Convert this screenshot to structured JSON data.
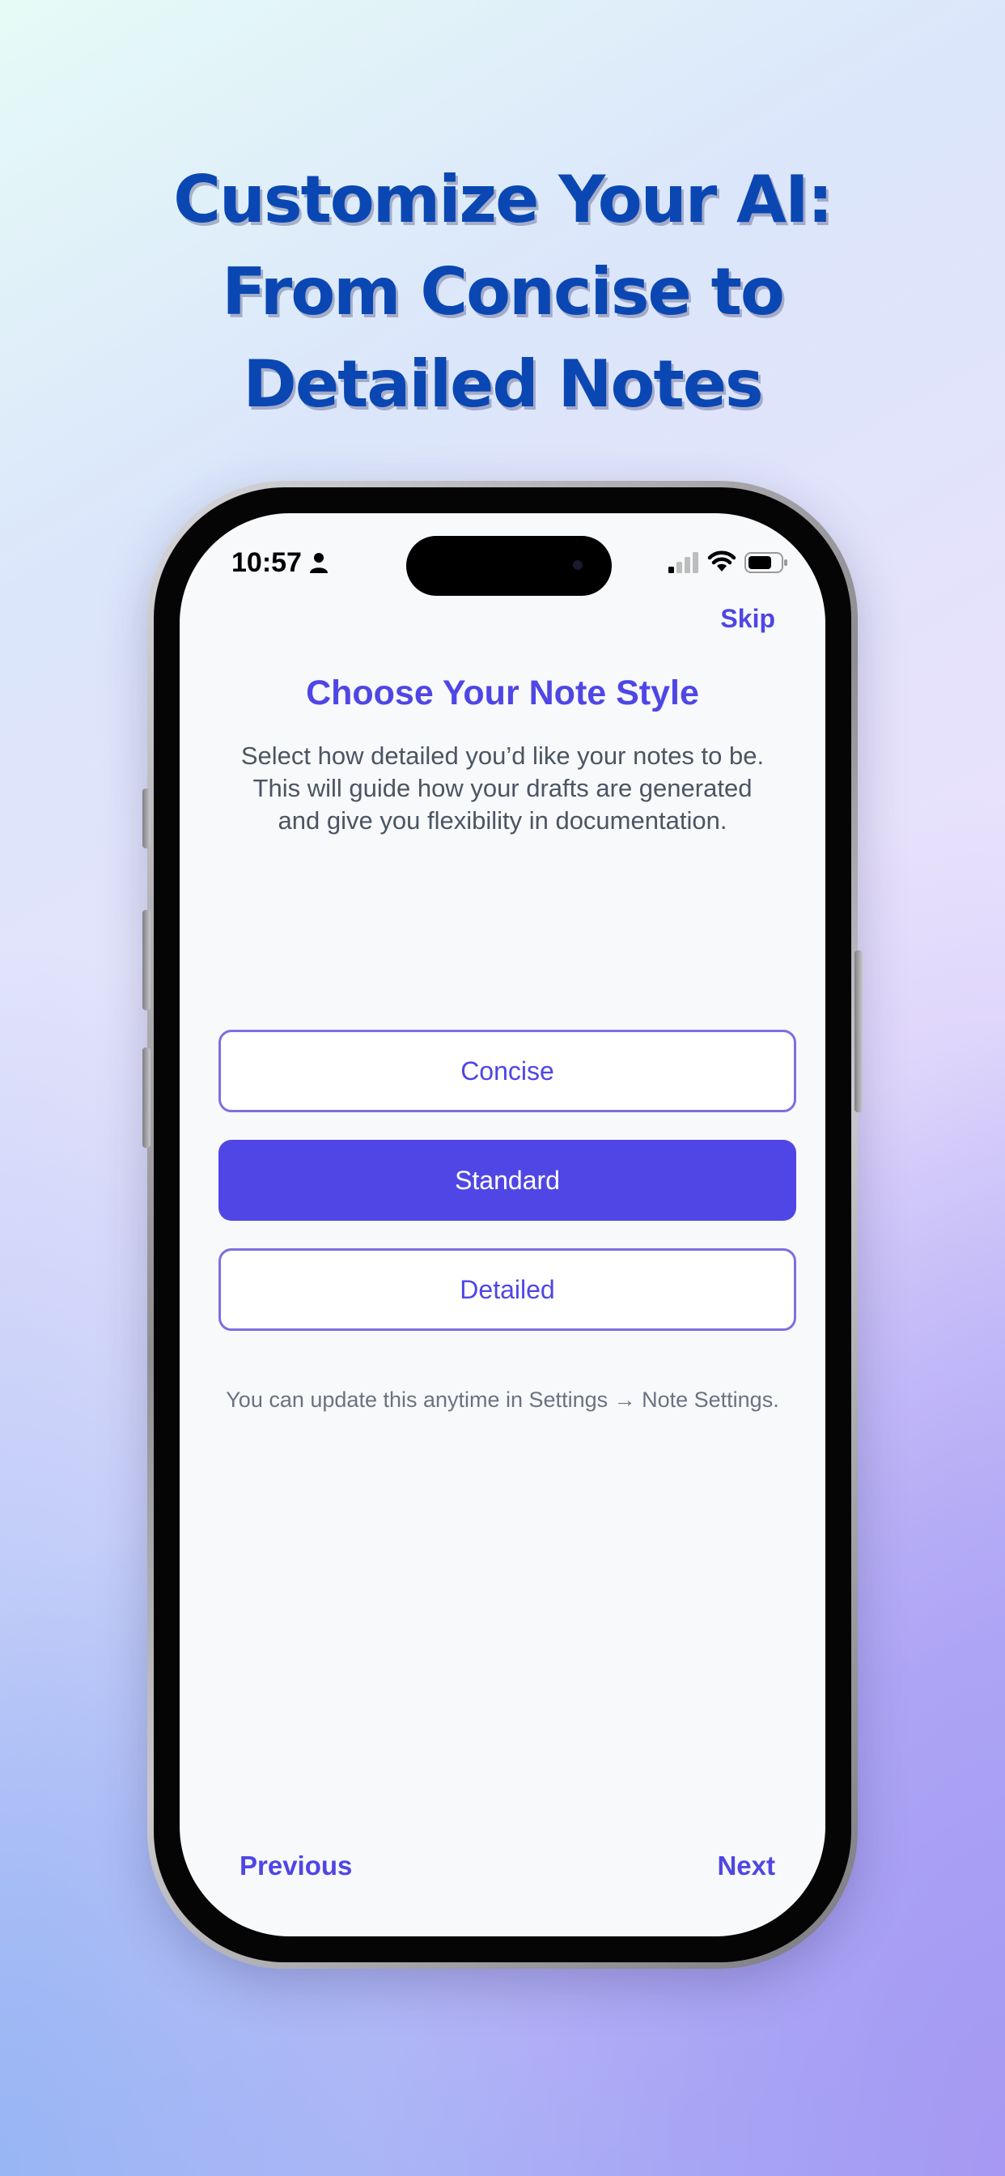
{
  "headline": {
    "lines": [
      "Customize Your AI:",
      "From Concise to",
      "Detailed Notes"
    ]
  },
  "status_bar": {
    "time": "10:57",
    "icons": [
      "person-icon",
      "signal-icon",
      "wifi-icon",
      "battery-icon"
    ]
  },
  "onboarding": {
    "skip_label": "Skip",
    "title": "Choose Your Note Style",
    "description_lines": [
      "Select how detailed you’d like your notes to be.",
      "This will guide how your drafts are generated",
      "and give you flexibility in documentation."
    ],
    "options": [
      {
        "label": "Concise",
        "selected": false
      },
      {
        "label": "Standard",
        "selected": true
      },
      {
        "label": "Detailed",
        "selected": false
      }
    ],
    "footnote": "You can update this anytime in Settings → Note Settings.",
    "previous_label": "Previous",
    "next_label": "Next"
  },
  "colors": {
    "accent": "#4f46e5",
    "headline": "#0a47b3",
    "body_text": "#4b5563",
    "muted_text": "#6b7280"
  }
}
